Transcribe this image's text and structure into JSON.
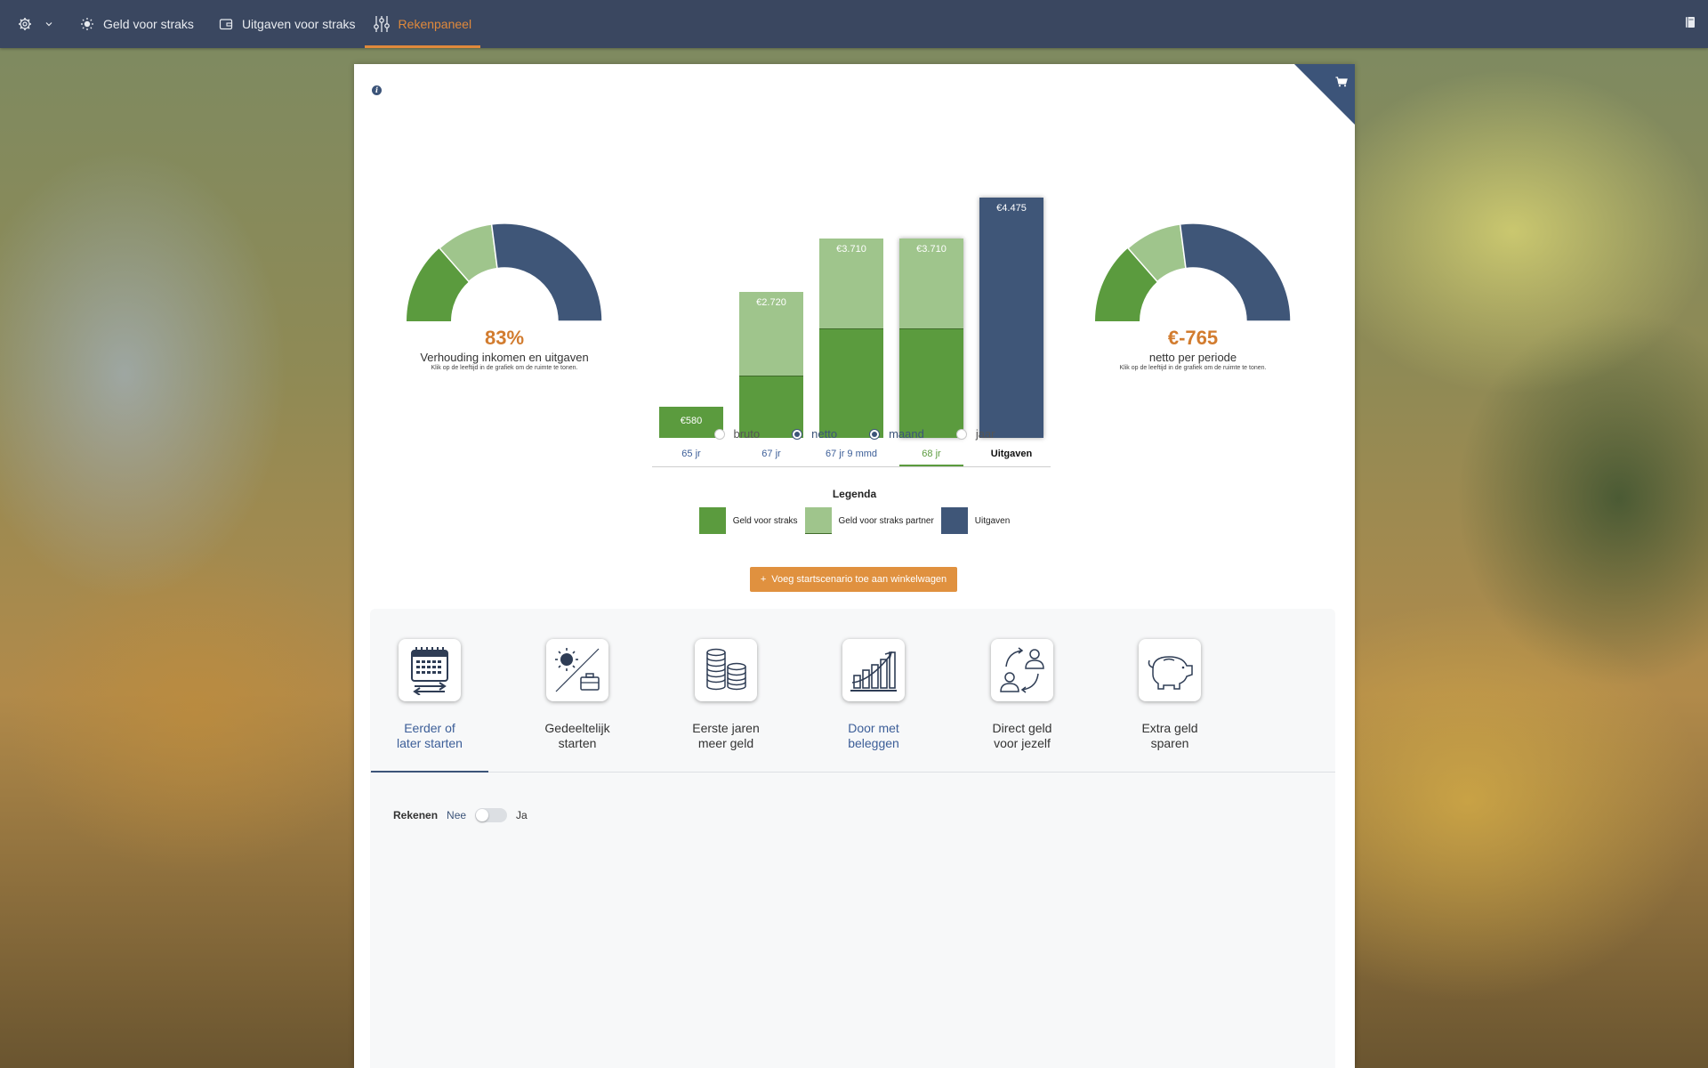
{
  "nav": {
    "items": [
      {
        "label": "Geld voor straks",
        "icon": "sun-icon"
      },
      {
        "label": "Uitgaven voor straks",
        "icon": "wallet-icon"
      },
      {
        "label": "Rekenpaneel",
        "icon": "sliders-icon",
        "active": true
      }
    ]
  },
  "gauges": {
    "left": {
      "value": "83%",
      "label": "Verhouding inkomen en uitgaven",
      "sub": "Klik op de leeftijd in de grafiek om de ruimte te tonen."
    },
    "right": {
      "value": "€-765",
      "label": "netto per periode",
      "sub": "Klik op de leeftijd in de grafiek om de ruimte te tonen."
    }
  },
  "chart_data": {
    "type": "bar",
    "categories": [
      "65 jr",
      "67 jr",
      "67 jr 9 mmd",
      "68 jr",
      "Uitgaven"
    ],
    "series": [
      {
        "name": "Geld voor straks",
        "values": [
          580,
          1150,
          2020,
          2020,
          0
        ]
      },
      {
        "name": "Geld voor straks partner",
        "values": [
          0,
          1570,
          1690,
          1690,
          0
        ]
      },
      {
        "name": "Uitgaven",
        "values": [
          0,
          0,
          0,
          0,
          4475
        ]
      }
    ],
    "totals_labels": [
      "€580",
      "€2.720",
      "€3.710",
      "€3.710",
      "€4.475"
    ],
    "totals": [
      580,
      2720,
      3710,
      3710,
      4475
    ],
    "selected_category": "68 jr",
    "ylim": [
      0,
      4475
    ]
  },
  "radios": [
    {
      "label": "bruto",
      "checked": false
    },
    {
      "label": "netto",
      "checked": true
    },
    {
      "label": "maand",
      "checked": true
    },
    {
      "label": "jaar",
      "checked": false
    }
  ],
  "legend": {
    "title": "Legenda",
    "items": [
      {
        "label": "Geld voor straks",
        "color": "#5b9b3e"
      },
      {
        "label": "Geld voor straks partner",
        "color": "#9fc58c"
      },
      {
        "label": "Uitgaven",
        "color": "#3f5678"
      }
    ]
  },
  "add_button": {
    "label": "Voeg startscenario toe aan winkelwagen"
  },
  "tabs": [
    {
      "line1": "Eerder of",
      "line2": "later starten",
      "icon": "calendar-icon"
    },
    {
      "line1": "Gedeeltelijk",
      "line2": "starten",
      "icon": "sun-briefcase-icon"
    },
    {
      "line1": "Eerste jaren",
      "line2": "meer geld",
      "icon": "coins-icon"
    },
    {
      "line1": "Door met",
      "line2": "beleggen",
      "icon": "growth-chart-icon"
    },
    {
      "line1": "Direct geld",
      "line2": "voor jezelf",
      "icon": "exchange-people-icon"
    },
    {
      "line1": "Extra geld",
      "line2": "sparen",
      "icon": "piggy-bank-icon"
    }
  ],
  "rekenen": {
    "label": "Rekenen",
    "off": "Nee",
    "on": "Ja"
  },
  "colors": {
    "accent": "#e0893b",
    "navy": "#3c5479",
    "green": "#5b9b3e",
    "light_green": "#9fc58c"
  }
}
